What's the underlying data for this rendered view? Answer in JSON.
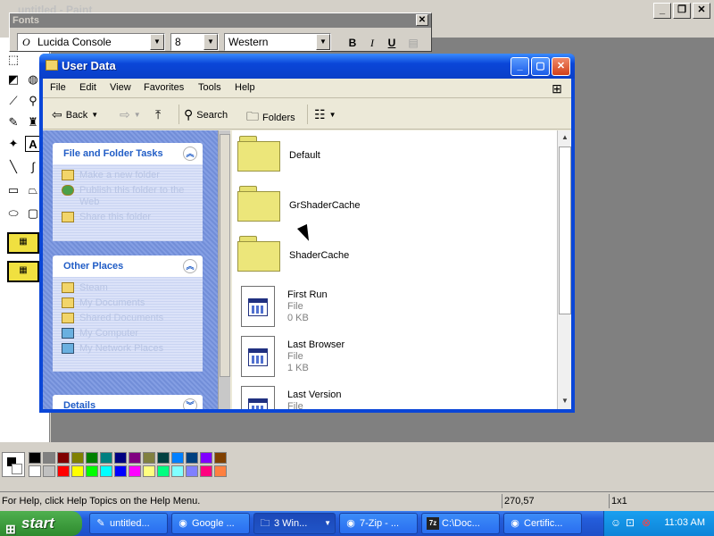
{
  "paint": {
    "title": "untitled - Paint",
    "status_help": "For Help, click Help Topics on the Help Menu.",
    "status_coords": "270,57",
    "status_size": "1x1",
    "palette_top": [
      "#000000",
      "#808080",
      "#800000",
      "#808000",
      "#008000",
      "#008080",
      "#000080",
      "#800080",
      "#808040",
      "#004040",
      "#0080ff",
      "#004080",
      "#8000ff",
      "#804000"
    ],
    "palette_bottom": [
      "#ffffff",
      "#c0c0c0",
      "#ff0000",
      "#ffff00",
      "#00ff00",
      "#00ffff",
      "#0000ff",
      "#ff00ff",
      "#ffff80",
      "#00ff80",
      "#80ffff",
      "#8080ff",
      "#ff0080",
      "#ff8040"
    ]
  },
  "fonts_bar": {
    "title": "Fonts",
    "font_name": "Lucida Console",
    "font_size": "8",
    "script": "Western",
    "bold": "B",
    "italic": "I",
    "underline": "U"
  },
  "explorer": {
    "title": "User Data",
    "menu": [
      "File",
      "Edit",
      "View",
      "Favorites",
      "Tools",
      "Help"
    ],
    "toolbar": {
      "back": "Back",
      "search": "Search",
      "folders": "Folders"
    },
    "tasks_panel": {
      "title": "File and Folder Tasks",
      "items": [
        "Make a new folder",
        "Publish this folder to the Web",
        "Share this folder"
      ]
    },
    "places_panel": {
      "title": "Other Places",
      "items": [
        "Steam",
        "My Documents",
        "Shared Documents",
        "My Computer",
        "My Network Places"
      ]
    },
    "details_panel": {
      "title": "Details"
    },
    "files": [
      {
        "name": "Default",
        "type": "folder"
      },
      {
        "name": "GrShaderCache",
        "type": "folder"
      },
      {
        "name": "ShaderCache",
        "type": "folder"
      },
      {
        "name": "First Run",
        "type": "file",
        "kind": "File",
        "size": "0 KB"
      },
      {
        "name": "Last Browser",
        "type": "file",
        "kind": "File",
        "size": "1 KB"
      },
      {
        "name": "Last Version",
        "type": "file",
        "kind": "File",
        "size": ""
      }
    ]
  },
  "taskbar": {
    "start_label": "start",
    "tasks": [
      {
        "label": "untitled...",
        "icon": "paint-icon"
      },
      {
        "label": "Google ...",
        "icon": "chrome-icon"
      },
      {
        "label": "3 Win...",
        "icon": "folder-icon"
      },
      {
        "label": "7-Zip - ...",
        "icon": "chrome-icon"
      },
      {
        "label": "C:\\Doc...",
        "icon": "7zip-icon"
      },
      {
        "label": "Certific...",
        "icon": "chrome-icon"
      }
    ],
    "clock": "11:03 AM"
  }
}
